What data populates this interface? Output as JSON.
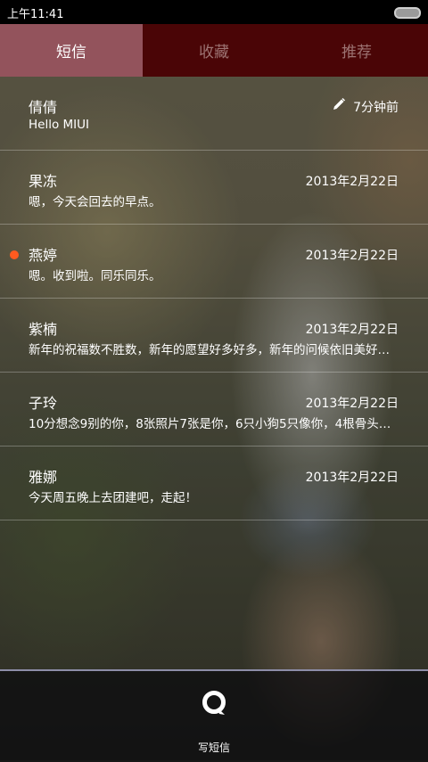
{
  "status_bar": {
    "time": "上午11:41"
  },
  "tabs": [
    {
      "label": "短信",
      "active": true
    },
    {
      "label": "收藏",
      "active": false
    },
    {
      "label": "推荐",
      "active": false
    }
  ],
  "accent_colors": {
    "active_tab": "#93535c",
    "inactive_tab": "#4a0506",
    "unread_dot": "#ff5a1f"
  },
  "messages": [
    {
      "name": "倩倩",
      "preview": "Hello MIUI",
      "time": "7分钟前",
      "icon": "pencil-icon"
    },
    {
      "name": "果冻",
      "preview": "嗯，今天会回去的早点。",
      "time": "2013年2月22日"
    },
    {
      "name": "燕婷",
      "preview": "嗯。收到啦。同乐同乐。",
      "time": "2013年2月22日",
      "unread": true
    },
    {
      "name": "紫楠",
      "preview": "新年的祝福数不胜数，新年的愿望好多好多，新年的问候依旧美好…",
      "time": "2013年2月22日"
    },
    {
      "name": "子玲",
      "preview": "10分想念9别的你，8张照片7张是你，6只小狗5只像你，4根骨头…",
      "time": "2013年2月22日"
    },
    {
      "name": "雅娜",
      "preview": "今天周五晚上去团建吧，走起！",
      "time": "2013年2月22日"
    }
  ],
  "bottom_bar": {
    "compose_label": "写短信",
    "icon": "compose-message-icon"
  }
}
